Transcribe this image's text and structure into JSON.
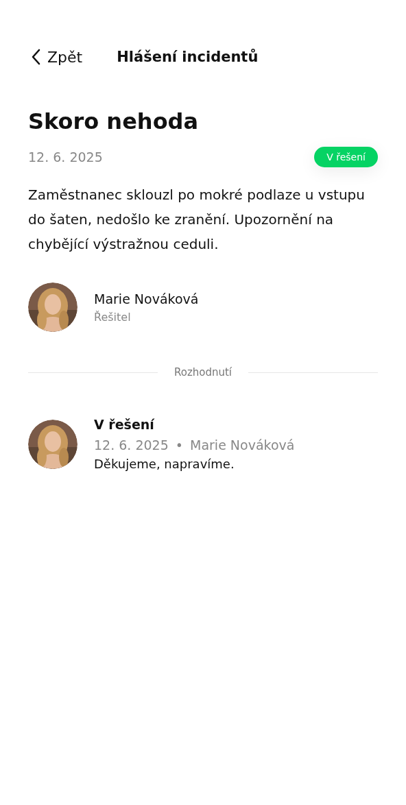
{
  "header": {
    "back_label": "Zpět",
    "title": "Hlášení incidentů"
  },
  "incident": {
    "title": "Skoro nehoda",
    "date": "12. 6. 2025",
    "status": "V řešení",
    "description": "Zaměstnanec sklouzl po mokré podlaze u vstupu do šaten, nedošlo ke zranění. Upozornění na chybějící výstražnou ceduli."
  },
  "assignee": {
    "name": "Marie Nováková",
    "role": "Řešitel"
  },
  "divider_label": "Rozhodnutí",
  "decisions": [
    {
      "status": "V řešení",
      "date": "12. 6. 2025",
      "separator": "•",
      "author": "Marie Nováková",
      "note": "Děkujeme, napravíme."
    }
  ]
}
